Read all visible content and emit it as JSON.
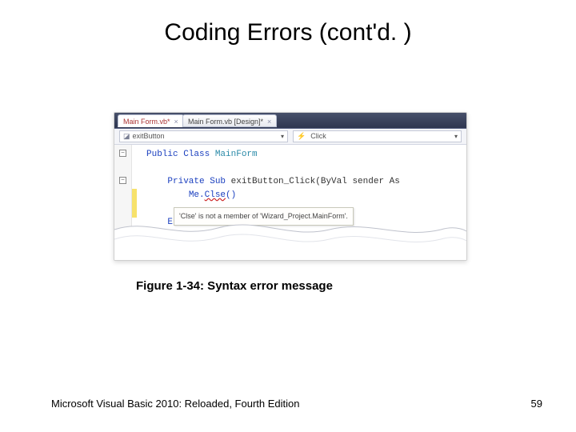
{
  "title": "Coding Errors (cont'd. )",
  "caption": "Figure 1-34: Syntax error message",
  "footer": "Microsoft Visual Basic 2010: Reloaded, Fourth Edition",
  "pageNumber": "59",
  "editor": {
    "tabs": {
      "active": "Main Form.vb*",
      "inactive": "Main Form.vb [Design]*",
      "close": "×"
    },
    "dropdowns": {
      "object": "exitButton",
      "event": "Click"
    },
    "code": {
      "line1_kw": "Public Class",
      "line1_type": " MainForm",
      "blank": "",
      "line2_kw": "Private Sub",
      "line2_rest": " exitButton_Click(ByVal sender As",
      "line3_pre": "Me",
      "line3_dot": ".",
      "line3_err": "Clse",
      "line3_post": "()",
      "line4_kw": "End Sub"
    },
    "tooltip": "'Clse' is not a member of 'Wizard_Project.MainForm'.",
    "glyph_minus": "−"
  }
}
